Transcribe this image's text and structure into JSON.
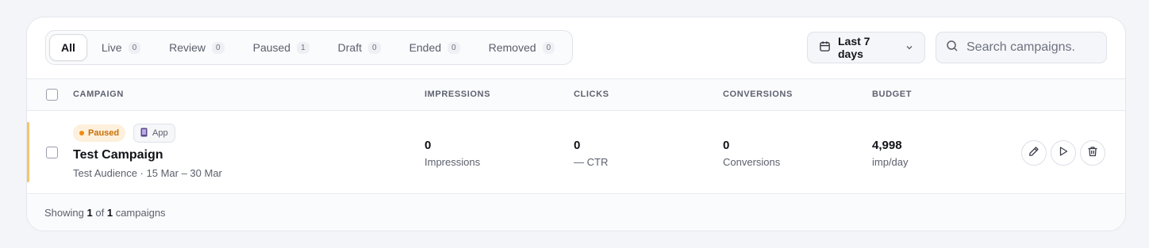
{
  "tabs": [
    {
      "label": "All",
      "count": null,
      "active": true
    },
    {
      "label": "Live",
      "count": "0"
    },
    {
      "label": "Review",
      "count": "0"
    },
    {
      "label": "Paused",
      "count": "1"
    },
    {
      "label": "Draft",
      "count": "0"
    },
    {
      "label": "Ended",
      "count": "0"
    },
    {
      "label": "Removed",
      "count": "0"
    }
  ],
  "date_filter": {
    "label": "Last 7 days",
    "icon": "calendar-icon"
  },
  "search": {
    "placeholder": "Search campaigns.",
    "value": "",
    "icon": "search-icon"
  },
  "columns": {
    "campaign": "CAMPAIGN",
    "impressions": "IMPRESSIONS",
    "clicks": "CLICKS",
    "conversions": "CONVERSIONS",
    "budget": "BUDGET"
  },
  "rows": [
    {
      "status": "Paused",
      "type_badge": "App",
      "name": "Test Campaign",
      "meta": "Test Audience · 15 Mar – 30 Mar",
      "impressions": {
        "value": "0",
        "label": "Impressions"
      },
      "clicks": {
        "value": "0",
        "label": "— CTR"
      },
      "conversions": {
        "value": "0",
        "label": "Conversions"
      },
      "budget": {
        "value": "4,998",
        "label": "imp/day"
      },
      "actions": [
        "edit-icon",
        "play-icon",
        "trash-icon"
      ]
    }
  ],
  "footer": {
    "prefix": "Showing",
    "shown": "1",
    "of": "of",
    "total": "1",
    "suffix": "campaigns"
  },
  "colors": {
    "paused_accent": "#f5c56d",
    "paused_text": "#c96f07",
    "paused_bg": "#fdf0dc"
  }
}
